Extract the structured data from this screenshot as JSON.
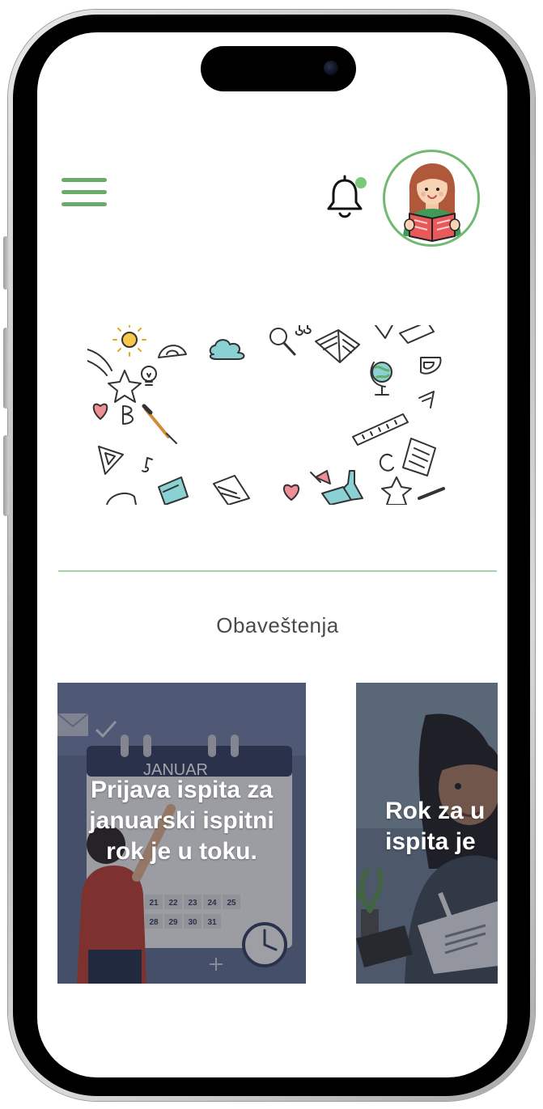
{
  "header": {
    "menu_icon": "hamburger-menu-icon",
    "notification_icon": "bell-icon",
    "notification_dot_color": "#7cc97c",
    "avatar_icon": "student-reading-avatar"
  },
  "banner": {
    "image_name": "school-doodles-banner"
  },
  "notifications": {
    "title": "Obaveštenja",
    "cards": [
      {
        "lines": [
          "Prijava ispita za",
          "januarski ispitni",
          "rok je u toku."
        ],
        "calendar_month": "JANUAR",
        "calendar_rows": [
          [
            "21",
            "22",
            "23",
            "24",
            "25"
          ],
          [
            "28",
            "29",
            "30",
            "31"
          ]
        ]
      },
      {
        "lines": [
          "Rok za u",
          "ispita je"
        ]
      }
    ]
  },
  "colors": {
    "accent": "#6aaa6a",
    "divider": "#a9cfa9",
    "text": "#4a4a4a"
  }
}
